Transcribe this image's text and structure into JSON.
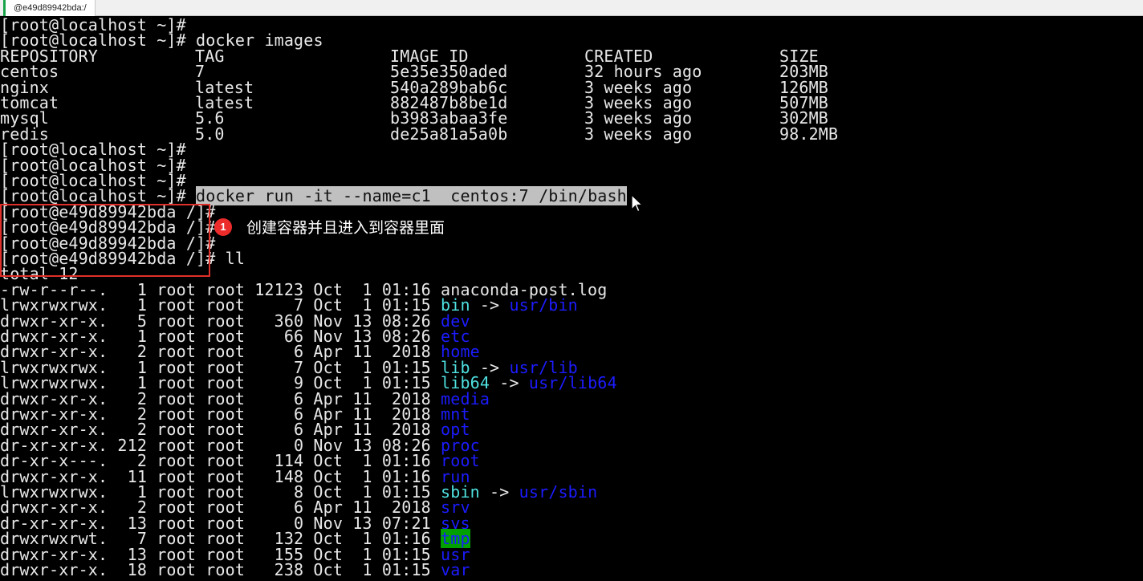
{
  "window": {
    "tab_title": "@e49d89942bda:/"
  },
  "terminal": {
    "prompt_host": "[root@localhost ~]#",
    "prompt_container": "[root@e49d89942bda /]#",
    "images_cmd": "docker images",
    "run_cmd": "docker run -it --name=c1  centos:7 /bin/bash",
    "ls_cmd": "ll",
    "images_headers": [
      "REPOSITORY",
      "TAG",
      "IMAGE ID",
      "CREATED",
      "SIZE"
    ],
    "images": [
      [
        "centos",
        "7",
        "5e35e350aded",
        "32 hours ago",
        "203MB"
      ],
      [
        "nginx",
        "latest",
        "540a289bab6c",
        "3 weeks ago",
        "126MB"
      ],
      [
        "tomcat",
        "latest",
        "882487b8be1d",
        "3 weeks ago",
        "507MB"
      ],
      [
        "mysql",
        "5.6",
        "b3983abaa3fe",
        "3 weeks ago",
        "302MB"
      ],
      [
        "redis",
        "5.0",
        "de25a81a5a0b",
        "3 weeks ago",
        "98.2MB"
      ]
    ],
    "total_line": "total 12",
    "ls_rows": [
      {
        "meta": "-rw-r--r--.   1 root root 12123 Oct  1 01:16 ",
        "name": "anaconda-post.log",
        "style": "plain",
        "target": ""
      },
      {
        "meta": "lrwxrwxrwx.   1 root root     7 Oct  1 01:15 ",
        "name": "bin",
        "style": "cyan",
        "target": "usr/bin"
      },
      {
        "meta": "drwxr-xr-x.   5 root root   360 Nov 13 08:26 ",
        "name": "dev",
        "style": "blue",
        "target": ""
      },
      {
        "meta": "drwxr-xr-x.   1 root root    66 Nov 13 08:26 ",
        "name": "etc",
        "style": "blue",
        "target": ""
      },
      {
        "meta": "drwxr-xr-x.   2 root root     6 Apr 11  2018 ",
        "name": "home",
        "style": "blue",
        "target": ""
      },
      {
        "meta": "lrwxrwxrwx.   1 root root     7 Oct  1 01:15 ",
        "name": "lib",
        "style": "cyan",
        "target": "usr/lib"
      },
      {
        "meta": "lrwxrwxrwx.   1 root root     9 Oct  1 01:15 ",
        "name": "lib64",
        "style": "cyan",
        "target": "usr/lib64"
      },
      {
        "meta": "drwxr-xr-x.   2 root root     6 Apr 11  2018 ",
        "name": "media",
        "style": "blue",
        "target": ""
      },
      {
        "meta": "drwxr-xr-x.   2 root root     6 Apr 11  2018 ",
        "name": "mnt",
        "style": "blue",
        "target": ""
      },
      {
        "meta": "drwxr-xr-x.   2 root root     6 Apr 11  2018 ",
        "name": "opt",
        "style": "blue",
        "target": ""
      },
      {
        "meta": "dr-xr-xr-x. 212 root root     0 Nov 13 08:26 ",
        "name": "proc",
        "style": "blue",
        "target": ""
      },
      {
        "meta": "dr-xr-x---.   2 root root   114 Oct  1 01:16 ",
        "name": "root",
        "style": "blue",
        "target": ""
      },
      {
        "meta": "drwxr-xr-x.  11 root root   148 Oct  1 01:16 ",
        "name": "run",
        "style": "blue",
        "target": ""
      },
      {
        "meta": "lrwxrwxrwx.   1 root root     8 Oct  1 01:15 ",
        "name": "sbin",
        "style": "cyan",
        "target": "usr/sbin"
      },
      {
        "meta": "drwxr-xr-x.   2 root root     6 Apr 11  2018 ",
        "name": "srv",
        "style": "blue",
        "target": ""
      },
      {
        "meta": "dr-xr-xr-x.  13 root root     0 Nov 13 07:21 ",
        "name": "sys",
        "style": "blue",
        "target": ""
      },
      {
        "meta": "drwxrwxrwt.   7 root root   132 Oct  1 01:16 ",
        "name": "tmp",
        "style": "tmp",
        "target": ""
      },
      {
        "meta": "drwxr-xr-x.  13 root root   155 Oct  1 01:15 ",
        "name": "usr",
        "style": "blue",
        "target": ""
      },
      {
        "meta": "drwxr-xr-x.  18 root root   238 Oct  1 01:15 ",
        "name": "var",
        "style": "blue",
        "target": ""
      }
    ]
  },
  "annotation": {
    "badge": "1",
    "text": "创建容器并且进入到容器里面",
    "box_color": "#e0302a",
    "badge_color": "#ec2b2b"
  },
  "colors": {
    "background": "#000000",
    "foreground": "#e8e8e8",
    "dir": "#1c1cff",
    "link": "#4fe0e0",
    "tmp_bg": "#00a000",
    "selection": "#c0c0c0"
  }
}
